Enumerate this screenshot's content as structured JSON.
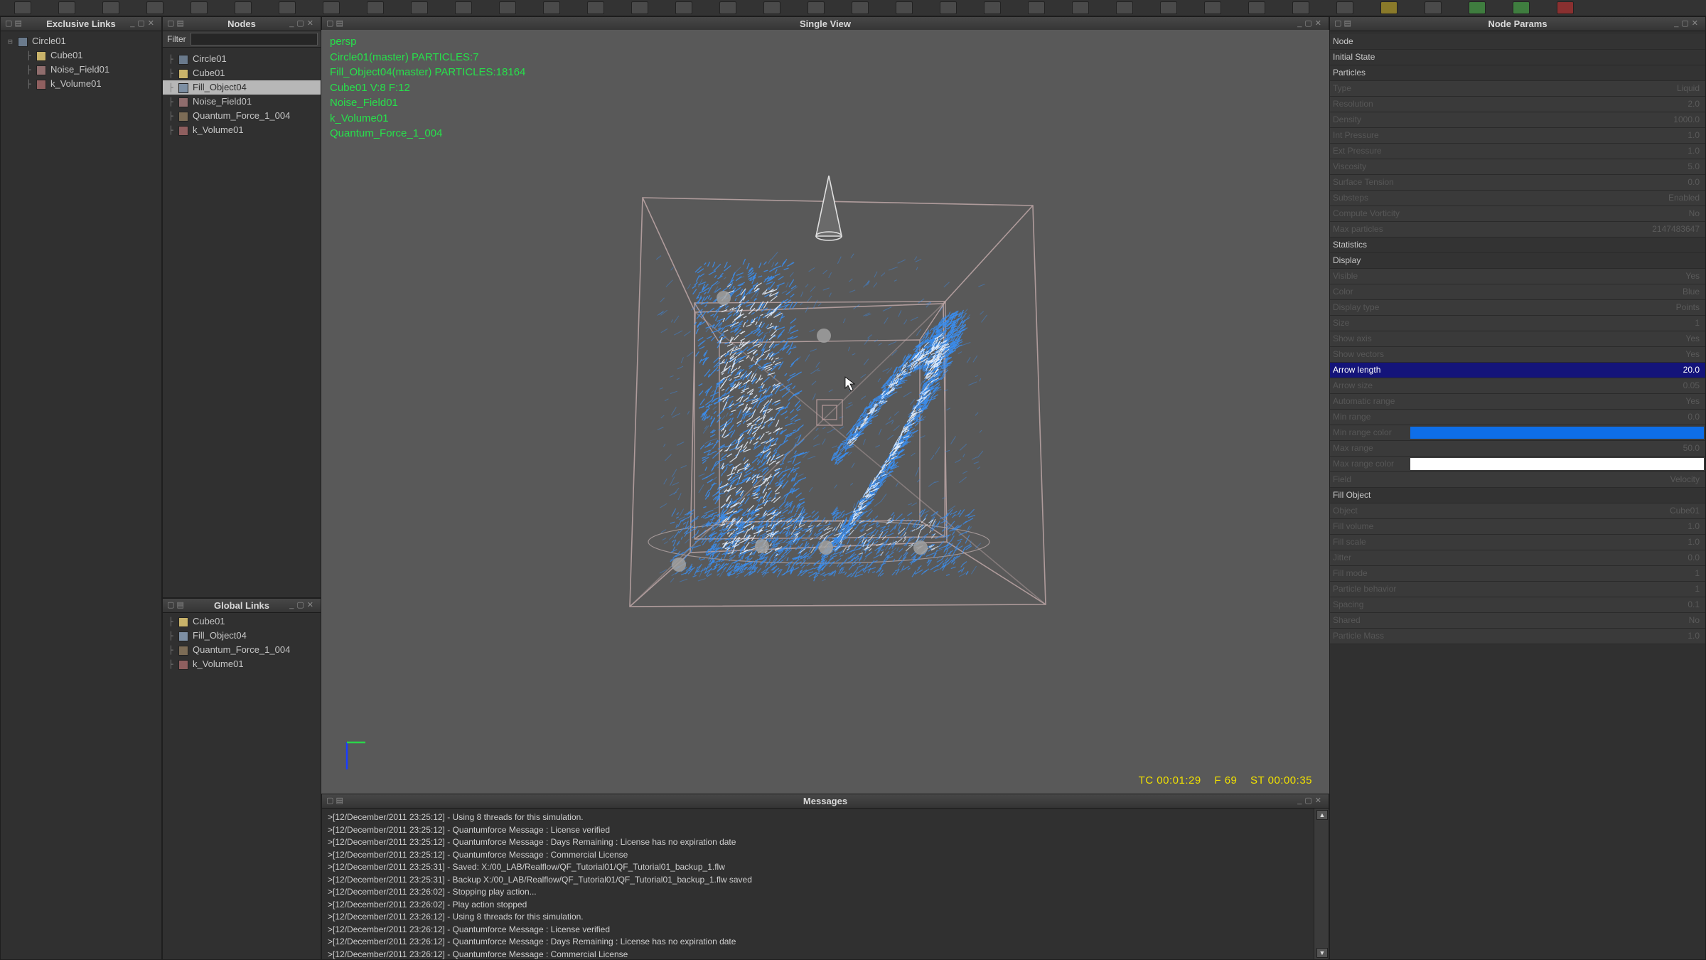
{
  "toolbar": {
    "buttons": 36
  },
  "exclusive_links": {
    "title": "Exclusive Links",
    "items": [
      {
        "label": "Circle01",
        "icon": "emitter-icon",
        "depth": 0
      },
      {
        "label": "Cube01",
        "icon": "cube-icon",
        "depth": 1
      },
      {
        "label": "Noise_Field01",
        "icon": "noise-field-icon",
        "depth": 1
      },
      {
        "label": "k_Volume01",
        "icon": "k-volume-icon",
        "depth": 1
      }
    ]
  },
  "nodes": {
    "title": "Nodes",
    "filter_label": "Filter",
    "items": [
      {
        "label": "Circle01",
        "icon": "emitter-icon"
      },
      {
        "label": "Cube01",
        "icon": "cube-icon"
      },
      {
        "label": "Fill_Object04",
        "icon": "fill-object-icon",
        "selected": true
      },
      {
        "label": "Noise_Field01",
        "icon": "noise-field-icon"
      },
      {
        "label": "Quantum_Force_1_004",
        "icon": "force-icon"
      },
      {
        "label": "k_Volume01",
        "icon": "k-volume-icon"
      }
    ]
  },
  "global_links": {
    "title": "Global Links",
    "items": [
      {
        "label": "Cube01",
        "icon": "cube-icon"
      },
      {
        "label": "Fill_Object04",
        "icon": "fill-object-icon"
      },
      {
        "label": "Quantum_Force_1_004",
        "icon": "force-icon"
      },
      {
        "label": "k_Volume01",
        "icon": "k-volume-icon"
      }
    ]
  },
  "viewport": {
    "title": "Single View",
    "info_lines": [
      "persp",
      "Circle01(master) PARTICLES:7",
      "Fill_Object04(master) PARTICLES:18164",
      "Cube01 V:8 F:12",
      "Noise_Field01",
      "k_Volume01",
      "Quantum_Force_1_004"
    ],
    "status": {
      "tc": "TC 00:01:29",
      "frame": "F 69",
      "st": "ST 00:00:35"
    }
  },
  "messages": {
    "title": "Messages",
    "lines": [
      ">[12/December/2011 23:25:12] - Using 8 threads for this simulation.",
      ">[12/December/2011 23:25:12] - Quantumforce Message : License verified",
      ">[12/December/2011 23:25:12] - Quantumforce Message : Days Remaining : License has no expiration date",
      ">[12/December/2011 23:25:12] - Quantumforce Message : Commercial License",
      ">[12/December/2011 23:25:31] - Saved: X:/00_LAB/Realflow/QF_Tutorial01/QF_Tutorial01_backup_1.flw",
      ">[12/December/2011 23:25:31] - Backup X:/00_LAB/Realflow/QF_Tutorial01/QF_Tutorial01_backup_1.flw saved",
      ">[12/December/2011 23:26:02] - Stopping play action...",
      ">[12/December/2011 23:26:02] - Play action stopped",
      ">[12/December/2011 23:26:12] - Using 8 threads for this simulation.",
      ">[12/December/2011 23:26:12] - Quantumforce Message : License verified",
      ">[12/December/2011 23:26:12] - Quantumforce Message : Days Remaining : License has no expiration date",
      ">[12/December/2011 23:26:12] - Quantumforce Message : Commercial License"
    ]
  },
  "node_params": {
    "title": "Node Params",
    "rows": [
      {
        "kind": "section",
        "label": "Node"
      },
      {
        "kind": "section",
        "label": "Initial State"
      },
      {
        "kind": "section",
        "label": "Particles"
      },
      {
        "kind": "field",
        "label": "Type",
        "value": "Liquid"
      },
      {
        "kind": "field",
        "label": "Resolution",
        "value": "2.0"
      },
      {
        "kind": "field",
        "label": "Density",
        "value": "1000.0"
      },
      {
        "kind": "field",
        "label": "Int Pressure",
        "value": "1.0"
      },
      {
        "kind": "field",
        "label": "Ext Pressure",
        "value": "1.0"
      },
      {
        "kind": "field",
        "label": "Viscosity",
        "value": "5.0"
      },
      {
        "kind": "field",
        "label": "Surface Tension",
        "value": "0.0"
      },
      {
        "kind": "field",
        "label": "Substeps",
        "value": "Enabled"
      },
      {
        "kind": "field",
        "label": "Compute Vorticity",
        "value": "No"
      },
      {
        "kind": "field",
        "label": "Max particles",
        "value": "2147483647"
      },
      {
        "kind": "section",
        "label": "Statistics"
      },
      {
        "kind": "section",
        "label": "Display"
      },
      {
        "kind": "field",
        "label": "Visible",
        "value": "Yes"
      },
      {
        "kind": "field",
        "label": "Color",
        "value": "Blue"
      },
      {
        "kind": "field",
        "label": "Display type",
        "value": "Points"
      },
      {
        "kind": "field",
        "label": "Size",
        "value": "1"
      },
      {
        "kind": "field",
        "label": "Show axis",
        "value": "Yes"
      },
      {
        "kind": "field",
        "label": "Show vectors",
        "value": "Yes"
      },
      {
        "kind": "field",
        "label": "Arrow length",
        "value": "20.0",
        "highlight": true
      },
      {
        "kind": "field",
        "label": "Arrow size",
        "value": "0.05"
      },
      {
        "kind": "field",
        "label": "Automatic range",
        "value": "Yes"
      },
      {
        "kind": "field",
        "label": "Min range",
        "value": "0.0"
      },
      {
        "kind": "field",
        "label": "Min range color",
        "value": "",
        "swatch": "#0e6ee8"
      },
      {
        "kind": "field",
        "label": "Max range",
        "value": "50.0"
      },
      {
        "kind": "field",
        "label": "Max range color",
        "value": "",
        "swatch": "#ffffff"
      },
      {
        "kind": "field",
        "label": "Field",
        "value": "Velocity"
      },
      {
        "kind": "section",
        "label": "Fill Object"
      },
      {
        "kind": "field",
        "label": "Object",
        "value": "Cube01"
      },
      {
        "kind": "field",
        "label": "Fill volume",
        "value": "1.0"
      },
      {
        "kind": "field",
        "label": "Fill scale",
        "value": "1.0"
      },
      {
        "kind": "field",
        "label": "Jitter",
        "value": "0.0"
      },
      {
        "kind": "field",
        "label": "Fill mode",
        "value": "1"
      },
      {
        "kind": "field",
        "label": "Particle behavior",
        "value": "1"
      },
      {
        "kind": "field",
        "label": "Spacing",
        "value": "0.1"
      },
      {
        "kind": "field",
        "label": "Shared",
        "value": "No"
      },
      {
        "kind": "field",
        "label": "Particle Mass",
        "value": "1.0"
      }
    ]
  },
  "colors": {
    "viewport_bg": "#595959",
    "info_text": "#27e04b",
    "status_text": "#f0e000",
    "particle_blue": "#3a8ef0",
    "highlight_row": "#14147a"
  }
}
